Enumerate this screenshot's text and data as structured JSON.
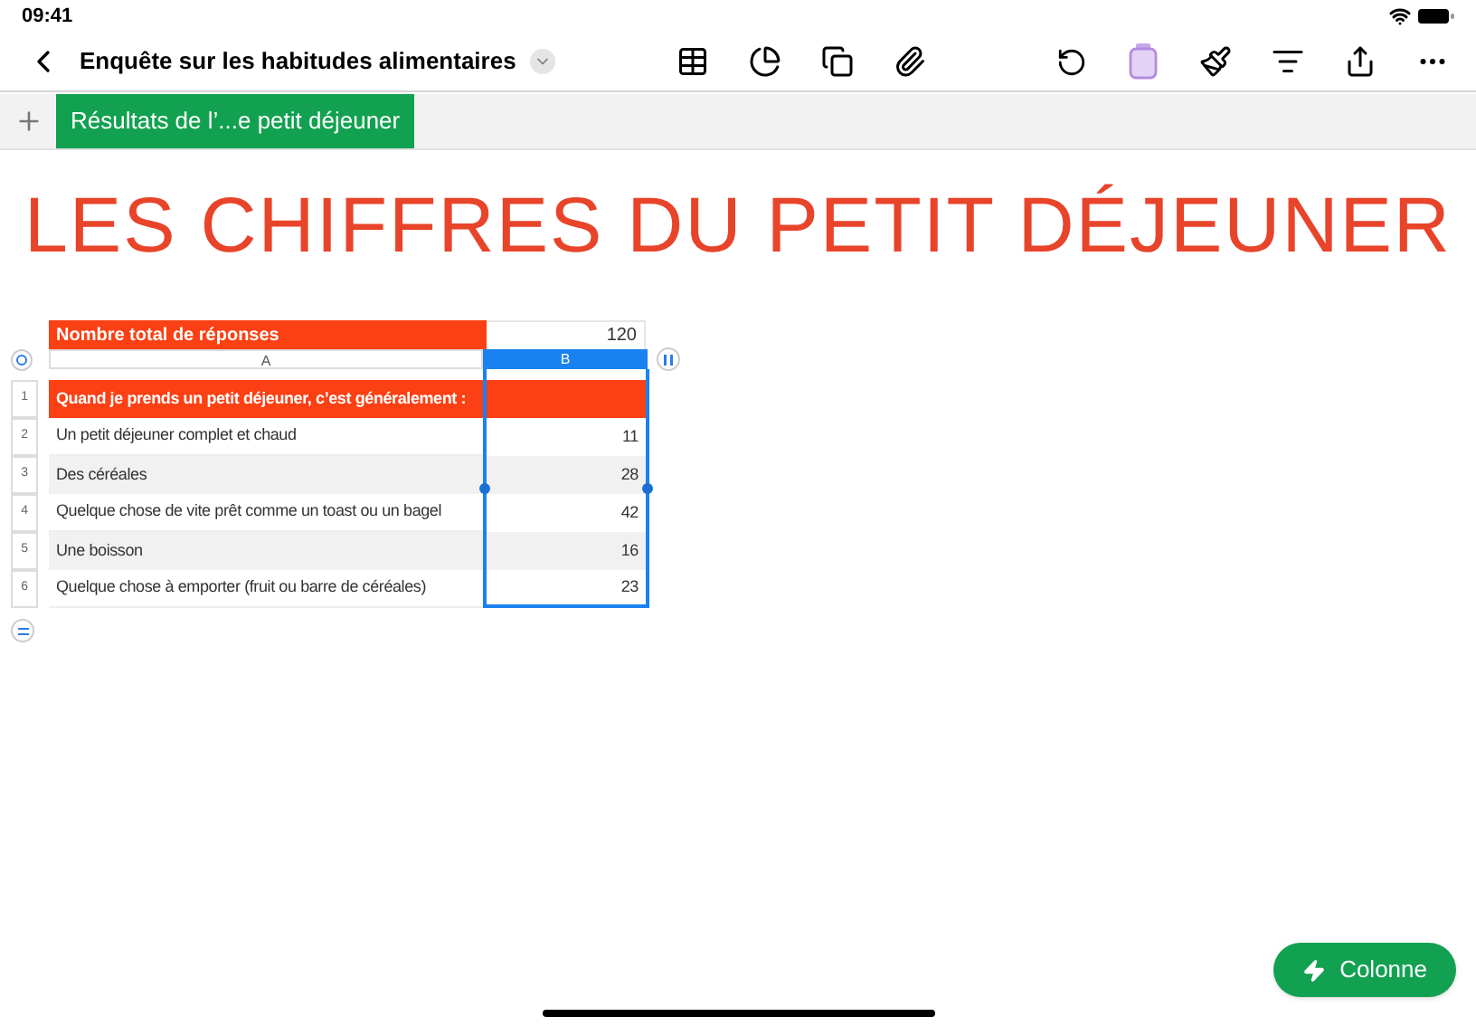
{
  "status_bar": {
    "time": "09:41"
  },
  "toolbar": {
    "title": "Enquête sur les habitudes alimentaires"
  },
  "sheet_tabs": [
    {
      "label": "Résultats de l’...e petit déjeuner",
      "selected": true
    }
  ],
  "heading": "LES CHIFFRES DU PETIT DÉJEUNER",
  "table": {
    "summary_row": {
      "label": "Nombre total de réponses",
      "value": "120"
    },
    "columns": [
      {
        "label": "A",
        "selected": false
      },
      {
        "label": "B",
        "selected": true
      }
    ],
    "rows": [
      {
        "number": "1",
        "kind": "header",
        "label": "Quand je prends un petit déjeuner, c’est généralement :"
      },
      {
        "number": "2",
        "kind": "body",
        "label": "Un petit déjeuner complet et chaud",
        "value": "11"
      },
      {
        "number": "3",
        "kind": "body",
        "label": "Des céréales",
        "value": "28"
      },
      {
        "number": "4",
        "kind": "body",
        "label": "Quelque chose de vite prêt comme un toast ou un bagel",
        "value": "42"
      },
      {
        "number": "5",
        "kind": "body",
        "label": "Une boisson",
        "value": "16"
      },
      {
        "number": "6",
        "kind": "body",
        "label": "Quelque chose à emporter (fruit ou barre de céréales)",
        "value": "23"
      }
    ]
  },
  "action_button": {
    "label": "Colonne"
  }
}
